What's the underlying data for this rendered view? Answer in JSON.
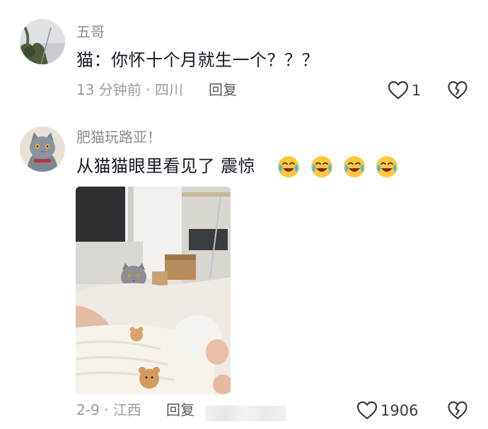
{
  "comments": [
    {
      "username": "五哥",
      "text": "猫：你怀十个月就生一个？？？",
      "meta": "13 分钟前 · 四川",
      "reply_label": "回复",
      "like_count": "1"
    },
    {
      "username": "肥猫玩路亚！",
      "text": "从猫猫眼里看见了 震惊",
      "meta": "2-9 · 江西",
      "reply_label": "回复",
      "like_count": "1906"
    }
  ],
  "icons": {
    "like": "heart-outline-icon",
    "dislike": "broken-heart-icon",
    "emoji": "crying-laughing-emoji"
  },
  "colors": {
    "text": "#161823",
    "meta": "#9b9ca2",
    "username": "#8a8b91",
    "emoji": "#ffc83d"
  }
}
